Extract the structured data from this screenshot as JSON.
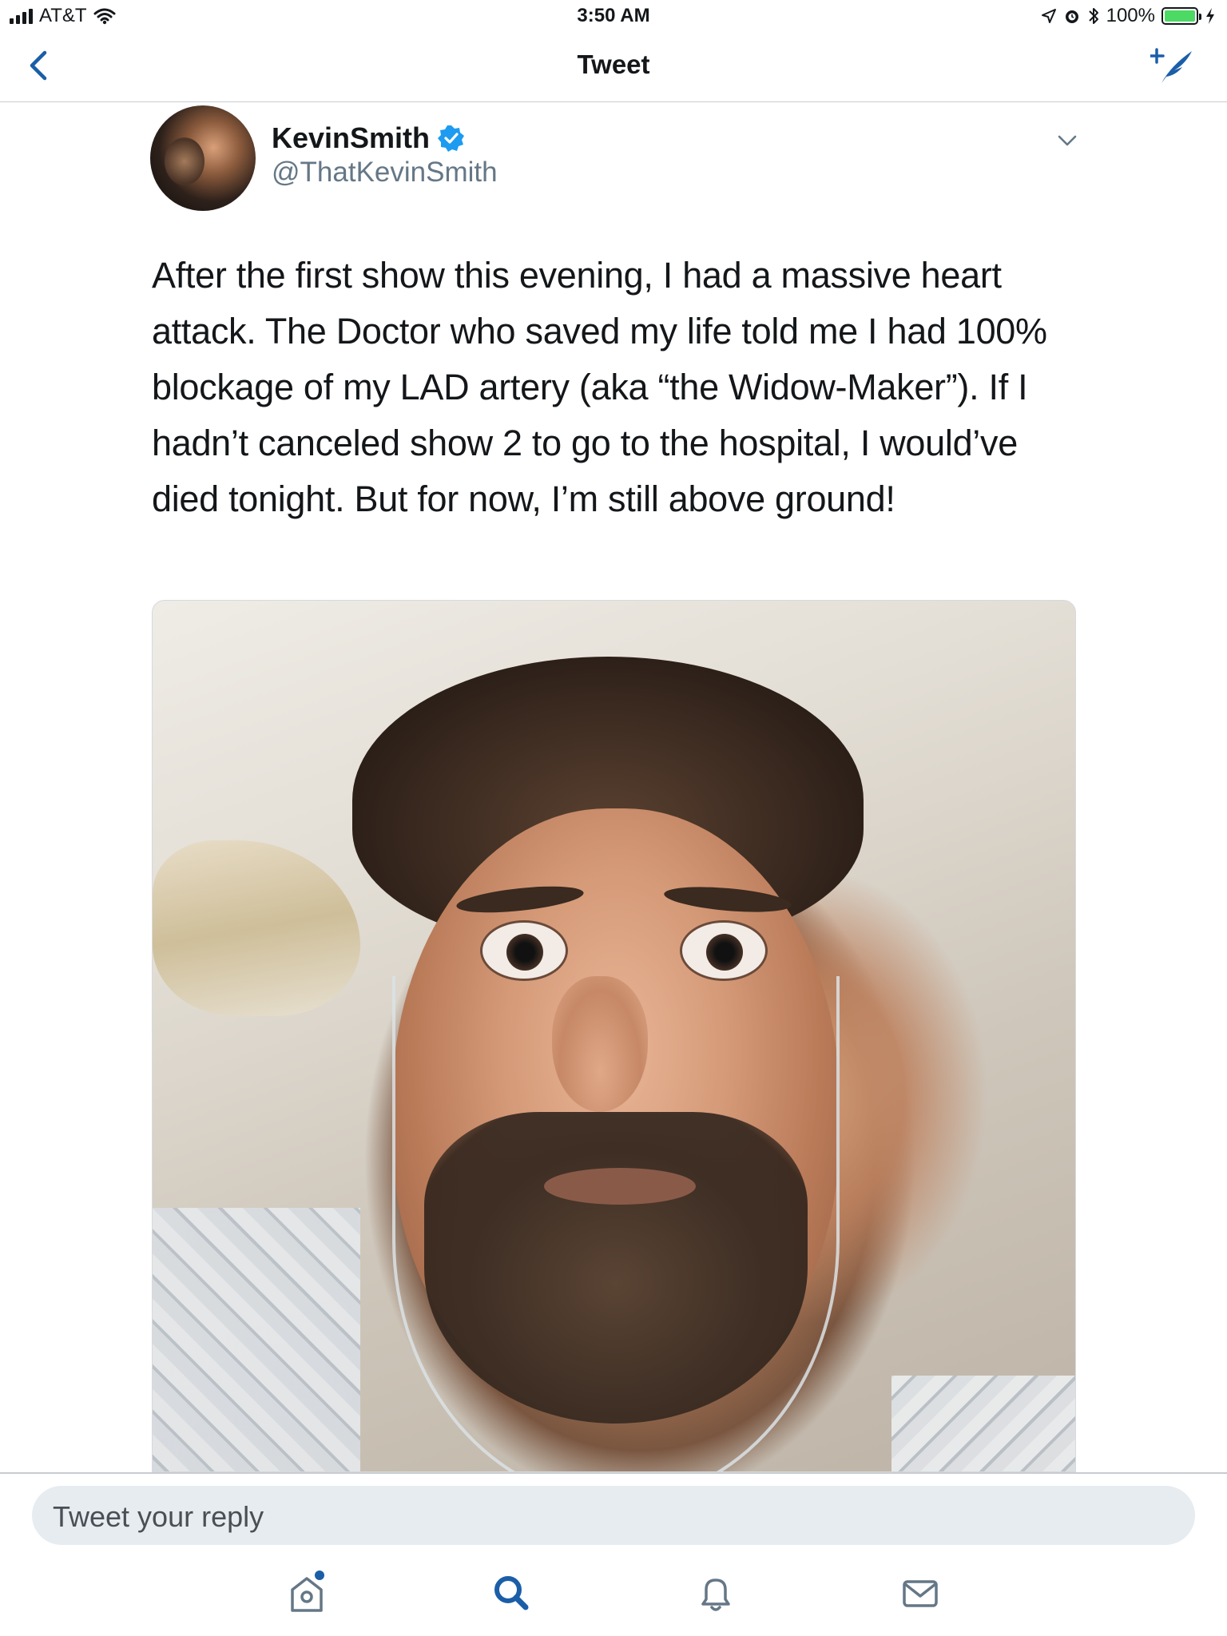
{
  "status_bar": {
    "carrier": "AT&T",
    "time": "3:50 AM",
    "battery": "100%"
  },
  "nav": {
    "title": "Tweet",
    "back_icon": "chevron-left-icon",
    "compose_icon": "compose-tweet-icon"
  },
  "tweet": {
    "author_name": "KevinSmith",
    "author_handle": "@ThatKevinSmith",
    "verified": true,
    "text": "After the first show this evening, I had a massive heart attack. The Doctor who saved my life told me I had 100% blockage of my LAD artery (aka “the Widow-Maker”). If I hadn’t canceled show 2 to go to the hospital, I would’ve died tonight. But for now, I’m still above ground!"
  },
  "reply": {
    "placeholder": "Tweet your reply"
  },
  "tabs": [
    {
      "name": "home",
      "icon": "home-icon",
      "has_notification_dot": true
    },
    {
      "name": "search",
      "icon": "search-icon",
      "active": true
    },
    {
      "name": "notifications",
      "icon": "bell-icon"
    },
    {
      "name": "messages",
      "icon": "envelope-icon"
    }
  ],
  "colors": {
    "accent": "#1da1f2",
    "icon_blue": "#1b5ea8",
    "text_primary": "#14171a",
    "text_secondary": "#657786",
    "verified": "#1d9bf0"
  }
}
